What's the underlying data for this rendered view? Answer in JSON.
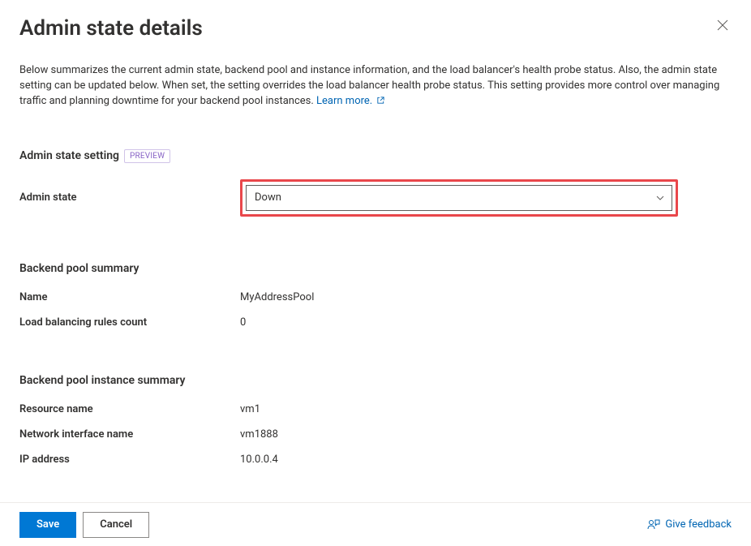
{
  "header": {
    "title": "Admin state details"
  },
  "description": {
    "text": "Below summarizes the current admin state, backend pool and instance information, and the load balancer's health probe status. Also, the admin state setting can be updated below. When set, the setting overrides the load balancer health probe status. This setting provides more control over managing traffic and planning downtime for your backend pool instances.",
    "learn_more_label": "Learn more."
  },
  "admin_state_section": {
    "heading": "Admin state setting",
    "preview_badge": "PREVIEW",
    "dropdown_label": "Admin state",
    "dropdown_value": "Down"
  },
  "backend_pool_section": {
    "heading": "Backend pool summary",
    "rows": {
      "name_label": "Name",
      "name_value": "MyAddressPool",
      "rules_label": "Load balancing rules count",
      "rules_value": "0"
    }
  },
  "instance_section": {
    "heading": "Backend pool instance summary",
    "rows": {
      "resource_label": "Resource name",
      "resource_value": "vm1",
      "nic_label": "Network interface name",
      "nic_value": "vm1888",
      "ip_label": "IP address",
      "ip_value": "10.0.0.4"
    }
  },
  "footer": {
    "save_label": "Save",
    "cancel_label": "Cancel",
    "feedback_label": "Give feedback"
  }
}
